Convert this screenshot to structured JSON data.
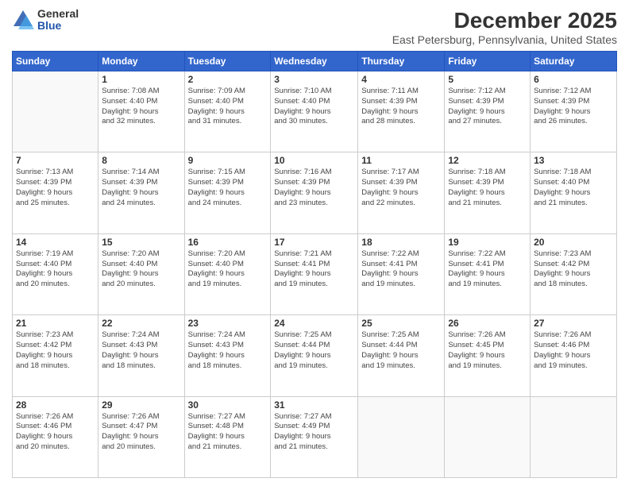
{
  "logo": {
    "general": "General",
    "blue": "Blue"
  },
  "title": "December 2025",
  "subtitle": "East Petersburg, Pennsylvania, United States",
  "weekdays": [
    "Sunday",
    "Monday",
    "Tuesday",
    "Wednesday",
    "Thursday",
    "Friday",
    "Saturday"
  ],
  "weeks": [
    [
      {
        "day": "",
        "info": ""
      },
      {
        "day": "1",
        "info": "Sunrise: 7:08 AM\nSunset: 4:40 PM\nDaylight: 9 hours\nand 32 minutes."
      },
      {
        "day": "2",
        "info": "Sunrise: 7:09 AM\nSunset: 4:40 PM\nDaylight: 9 hours\nand 31 minutes."
      },
      {
        "day": "3",
        "info": "Sunrise: 7:10 AM\nSunset: 4:40 PM\nDaylight: 9 hours\nand 30 minutes."
      },
      {
        "day": "4",
        "info": "Sunrise: 7:11 AM\nSunset: 4:39 PM\nDaylight: 9 hours\nand 28 minutes."
      },
      {
        "day": "5",
        "info": "Sunrise: 7:12 AM\nSunset: 4:39 PM\nDaylight: 9 hours\nand 27 minutes."
      },
      {
        "day": "6",
        "info": "Sunrise: 7:12 AM\nSunset: 4:39 PM\nDaylight: 9 hours\nand 26 minutes."
      }
    ],
    [
      {
        "day": "7",
        "info": "Sunrise: 7:13 AM\nSunset: 4:39 PM\nDaylight: 9 hours\nand 25 minutes."
      },
      {
        "day": "8",
        "info": "Sunrise: 7:14 AM\nSunset: 4:39 PM\nDaylight: 9 hours\nand 24 minutes."
      },
      {
        "day": "9",
        "info": "Sunrise: 7:15 AM\nSunset: 4:39 PM\nDaylight: 9 hours\nand 24 minutes."
      },
      {
        "day": "10",
        "info": "Sunrise: 7:16 AM\nSunset: 4:39 PM\nDaylight: 9 hours\nand 23 minutes."
      },
      {
        "day": "11",
        "info": "Sunrise: 7:17 AM\nSunset: 4:39 PM\nDaylight: 9 hours\nand 22 minutes."
      },
      {
        "day": "12",
        "info": "Sunrise: 7:18 AM\nSunset: 4:39 PM\nDaylight: 9 hours\nand 21 minutes."
      },
      {
        "day": "13",
        "info": "Sunrise: 7:18 AM\nSunset: 4:40 PM\nDaylight: 9 hours\nand 21 minutes."
      }
    ],
    [
      {
        "day": "14",
        "info": "Sunrise: 7:19 AM\nSunset: 4:40 PM\nDaylight: 9 hours\nand 20 minutes."
      },
      {
        "day": "15",
        "info": "Sunrise: 7:20 AM\nSunset: 4:40 PM\nDaylight: 9 hours\nand 20 minutes."
      },
      {
        "day": "16",
        "info": "Sunrise: 7:20 AM\nSunset: 4:40 PM\nDaylight: 9 hours\nand 19 minutes."
      },
      {
        "day": "17",
        "info": "Sunrise: 7:21 AM\nSunset: 4:41 PM\nDaylight: 9 hours\nand 19 minutes."
      },
      {
        "day": "18",
        "info": "Sunrise: 7:22 AM\nSunset: 4:41 PM\nDaylight: 9 hours\nand 19 minutes."
      },
      {
        "day": "19",
        "info": "Sunrise: 7:22 AM\nSunset: 4:41 PM\nDaylight: 9 hours\nand 19 minutes."
      },
      {
        "day": "20",
        "info": "Sunrise: 7:23 AM\nSunset: 4:42 PM\nDaylight: 9 hours\nand 18 minutes."
      }
    ],
    [
      {
        "day": "21",
        "info": "Sunrise: 7:23 AM\nSunset: 4:42 PM\nDaylight: 9 hours\nand 18 minutes."
      },
      {
        "day": "22",
        "info": "Sunrise: 7:24 AM\nSunset: 4:43 PM\nDaylight: 9 hours\nand 18 minutes."
      },
      {
        "day": "23",
        "info": "Sunrise: 7:24 AM\nSunset: 4:43 PM\nDaylight: 9 hours\nand 18 minutes."
      },
      {
        "day": "24",
        "info": "Sunrise: 7:25 AM\nSunset: 4:44 PM\nDaylight: 9 hours\nand 19 minutes."
      },
      {
        "day": "25",
        "info": "Sunrise: 7:25 AM\nSunset: 4:44 PM\nDaylight: 9 hours\nand 19 minutes."
      },
      {
        "day": "26",
        "info": "Sunrise: 7:26 AM\nSunset: 4:45 PM\nDaylight: 9 hours\nand 19 minutes."
      },
      {
        "day": "27",
        "info": "Sunrise: 7:26 AM\nSunset: 4:46 PM\nDaylight: 9 hours\nand 19 minutes."
      }
    ],
    [
      {
        "day": "28",
        "info": "Sunrise: 7:26 AM\nSunset: 4:46 PM\nDaylight: 9 hours\nand 20 minutes."
      },
      {
        "day": "29",
        "info": "Sunrise: 7:26 AM\nSunset: 4:47 PM\nDaylight: 9 hours\nand 20 minutes."
      },
      {
        "day": "30",
        "info": "Sunrise: 7:27 AM\nSunset: 4:48 PM\nDaylight: 9 hours\nand 21 minutes."
      },
      {
        "day": "31",
        "info": "Sunrise: 7:27 AM\nSunset: 4:49 PM\nDaylight: 9 hours\nand 21 minutes."
      },
      {
        "day": "",
        "info": ""
      },
      {
        "day": "",
        "info": ""
      },
      {
        "day": "",
        "info": ""
      }
    ]
  ]
}
